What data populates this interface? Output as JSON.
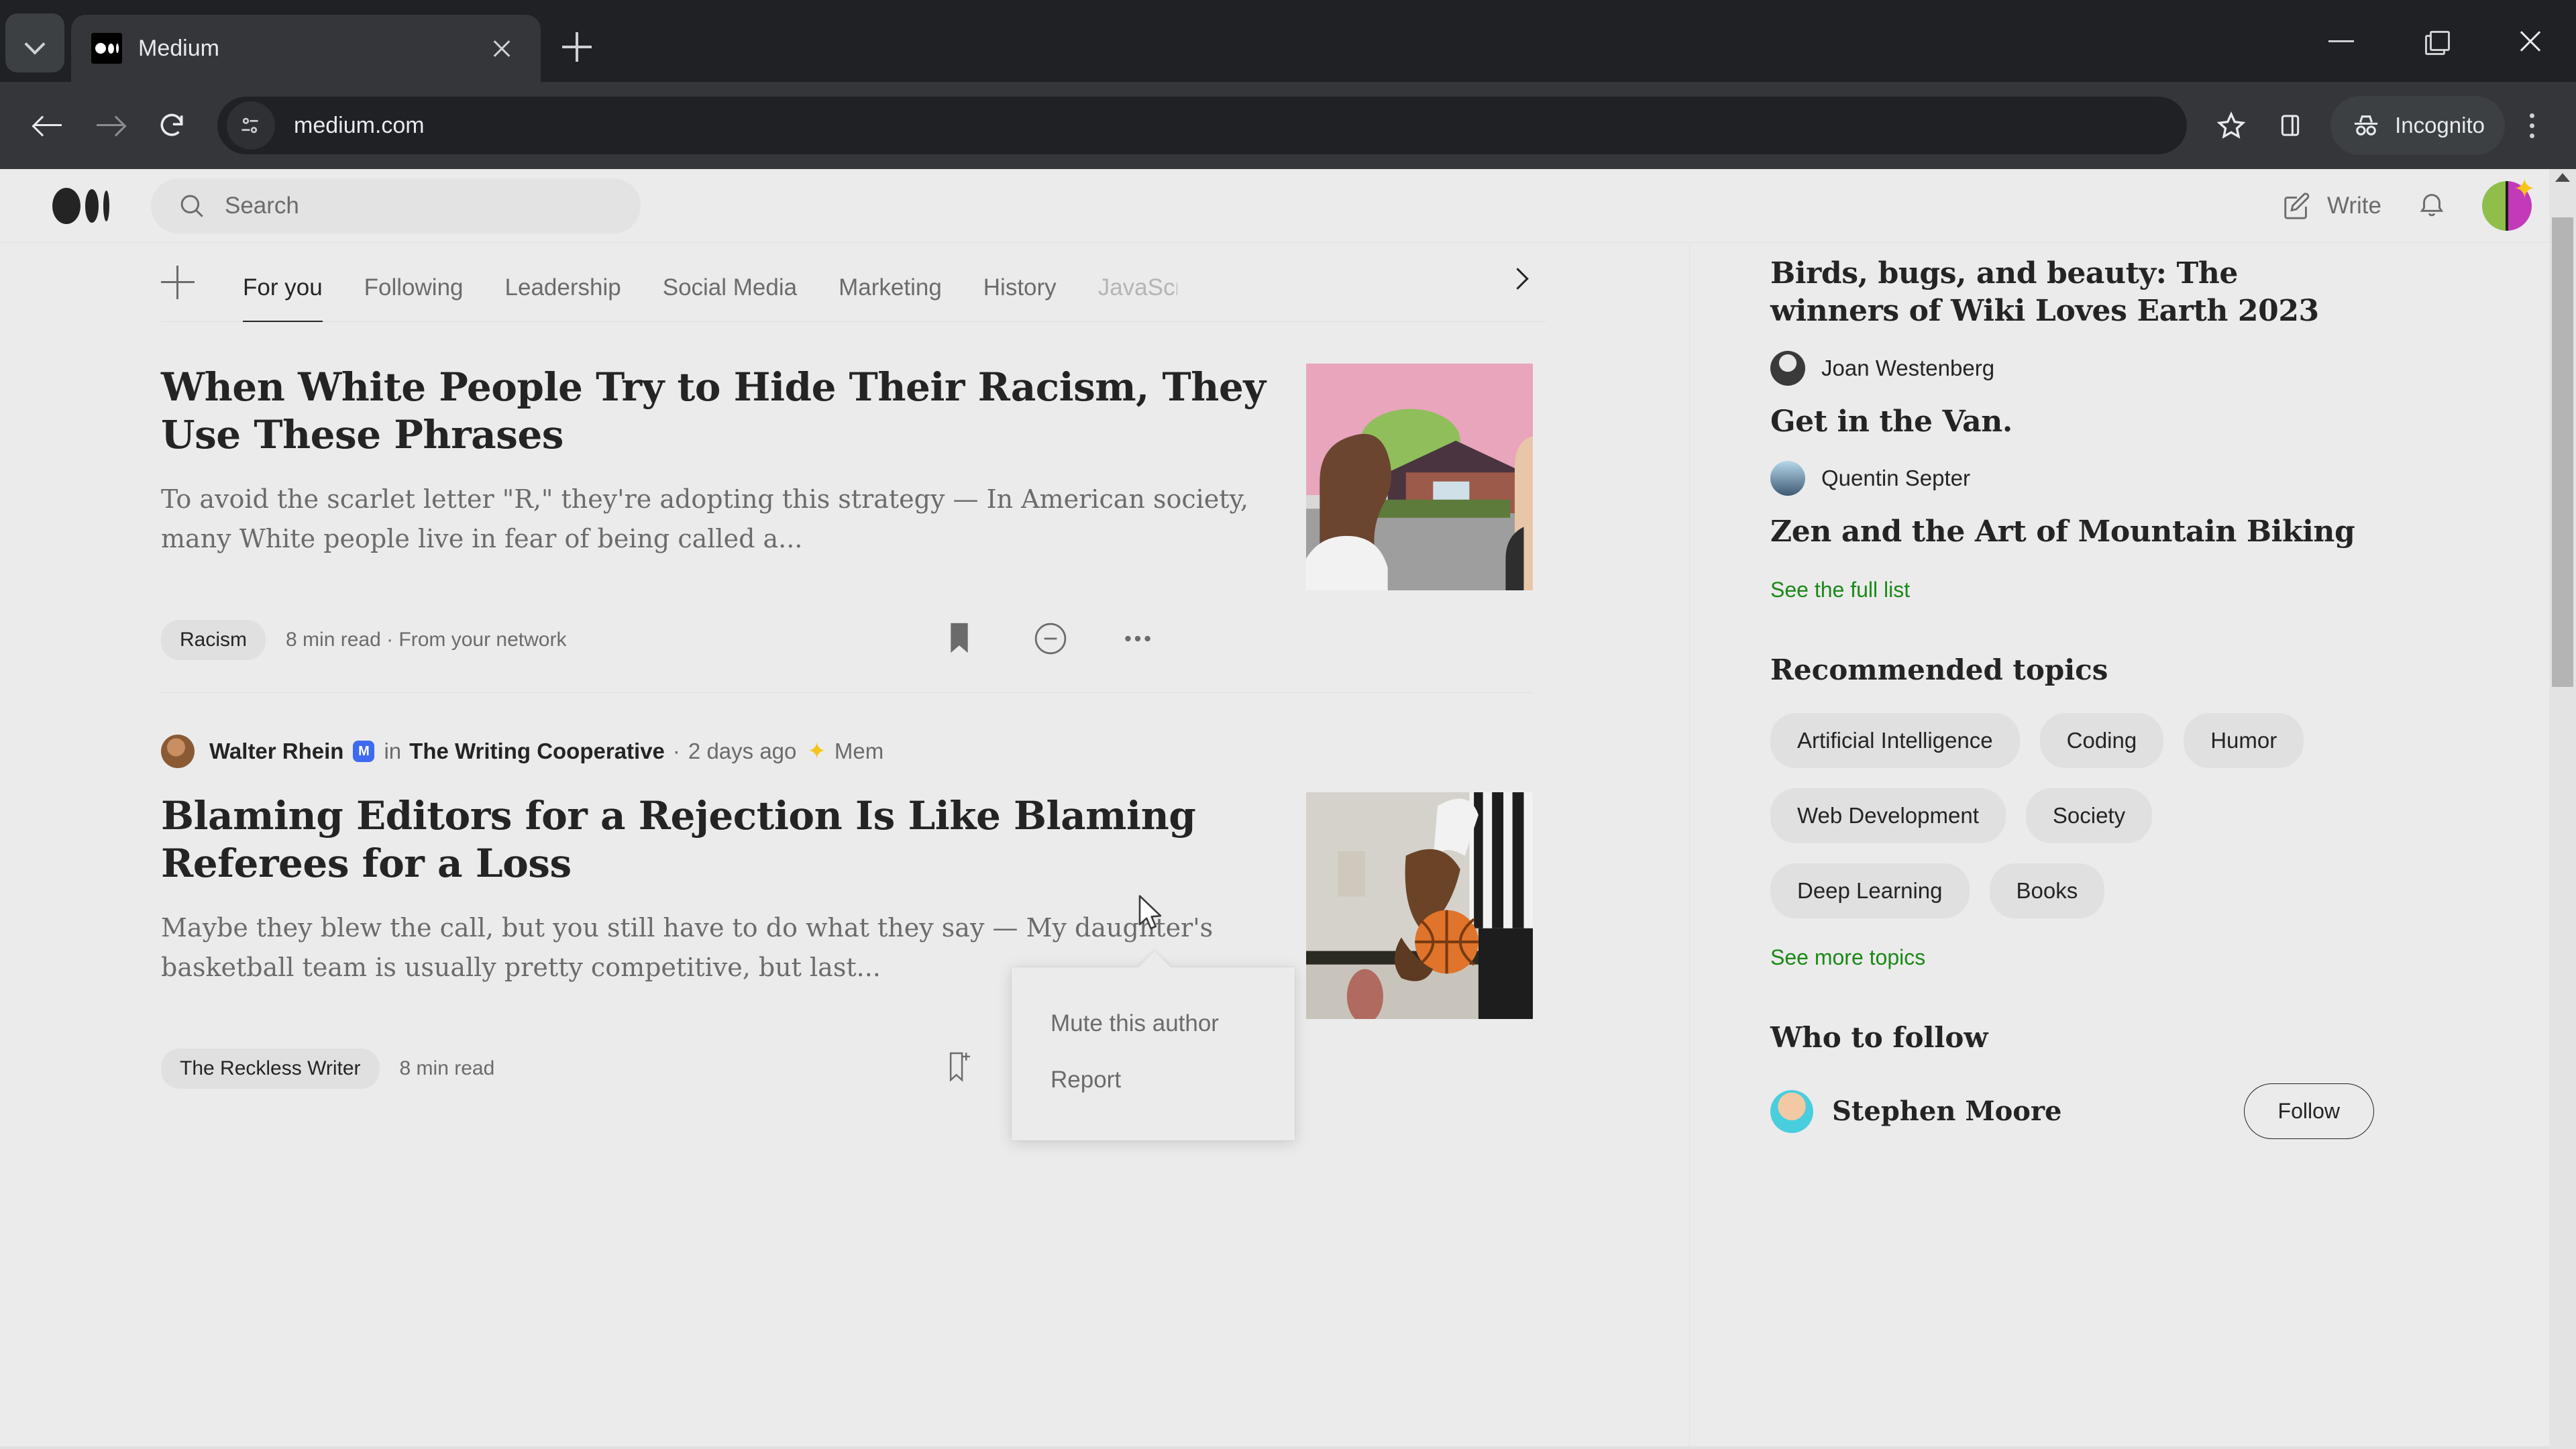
{
  "browser": {
    "tab": {
      "title": "Medium",
      "favicon_icon": "medium-logo-icon",
      "close_icon": "close-icon"
    },
    "tab_list_icon": "chevron-down-icon",
    "new_tab_icon": "plus-icon",
    "window_controls": {
      "minimize_icon": "minimize-icon",
      "maximize_icon": "restore-icon",
      "close_icon": "close-icon"
    },
    "toolbar": {
      "back_icon": "back-arrow-icon",
      "forward_icon": "forward-arrow-icon",
      "reload_icon": "reload-icon",
      "site_info_icon": "site-settings-icon",
      "url": "medium.com",
      "bookmark_icon": "star-icon",
      "side_panel_icon": "side-panel-icon",
      "incognito_icon": "incognito-hat-icon",
      "incognito_label": "Incognito",
      "menu_icon": "kebab-menu-icon"
    }
  },
  "header": {
    "logo_icon": "medium-logo-icon",
    "search_placeholder": "Search",
    "search_icon": "search-icon",
    "write_icon": "write-pencil-icon",
    "write_label": "Write",
    "notifications_icon": "bell-icon",
    "avatar_icon": "user-avatar",
    "avatar_badge_icon": "sparkle-star-icon"
  },
  "feed_tabs": {
    "add_icon": "plus-icon",
    "next_icon": "chevron-right-icon",
    "items": [
      {
        "label": "For you",
        "active": true
      },
      {
        "label": "Following",
        "active": false
      },
      {
        "label": "Leadership",
        "active": false
      },
      {
        "label": "Social Media",
        "active": false
      },
      {
        "label": "Marketing",
        "active": false
      },
      {
        "label": "History",
        "active": false
      },
      {
        "label": "JavaScript",
        "active": false,
        "faded": true
      }
    ]
  },
  "articles": [
    {
      "title": "When White People Try to Hide Their Racism, They Use These Phrases",
      "subtitle": "To avoid the scarlet letter \"R,\" they're adopting this strategy — In American society, many White people live in fear of being called a...",
      "tag": "Racism",
      "meta": "8 min read  ·  From your network",
      "bookmark_icon": "bookmark-filled-icon",
      "mute_icon": "minus-circle-icon",
      "more_icon": "ellipsis-icon",
      "thumb_alt": "two-people-talking-illustration"
    },
    {
      "byline": {
        "avatar_icon": "author-avatar",
        "author": "Walter Rhein",
        "badge_icon": "publication-badge-icon",
        "in_word": "in",
        "publication": "The Writing Cooperative",
        "separator": "·",
        "date": "2 days ago",
        "member_star_icon": "member-star-icon",
        "member_label": "Mem"
      },
      "title": "Blaming Editors for a Rejection Is Like Blaming Referees for a Loss",
      "subtitle": "Maybe they blew the call, but you still have to do what they say — My daughter's basketball team is usually pretty competitive, but last...",
      "tag": "The Reckless Writer",
      "meta": "8 min read",
      "bookmark_icon": "bookmark-add-icon",
      "mute_icon": "minus-circle-icon",
      "more_icon": "ellipsis-icon",
      "thumb_alt": "referee-holding-basketball-photo"
    }
  ],
  "dropdown": {
    "items": [
      {
        "label": "Mute this author"
      },
      {
        "label": "Report"
      }
    ]
  },
  "sidebar": {
    "staff_picks": [
      {
        "title": "Birds, bugs, and beauty: The winners of Wiki Loves Earth 2023",
        "author": "Joan Westenberg",
        "avatar_icon": "author-avatar"
      },
      {
        "title": "Get in the Van.",
        "author": "Quentin Septer",
        "avatar_icon": "author-avatar"
      },
      {
        "title": "Zen and the Art of Mountain Biking",
        "author": "",
        "avatar_icon": ""
      }
    ],
    "see_full_list": "See the full list",
    "recommended_topics_heading": "Recommended topics",
    "topics": [
      "Artificial Intelligence",
      "Coding",
      "Humor",
      "Web Development",
      "Society",
      "Deep Learning",
      "Books"
    ],
    "see_more_topics": "See more topics",
    "who_to_follow_heading": "Who to follow",
    "people": [
      {
        "name": "Stephen Moore",
        "follow_label": "Follow",
        "avatar_icon": "user-avatar"
      }
    ]
  },
  "colors": {
    "accent_green": "#1a8917",
    "page_bg": "#ebebeb",
    "chrome_dark": "#202124",
    "toolbar_dark": "#35363a",
    "text_primary": "#242424",
    "text_muted": "#6b6b6b"
  }
}
